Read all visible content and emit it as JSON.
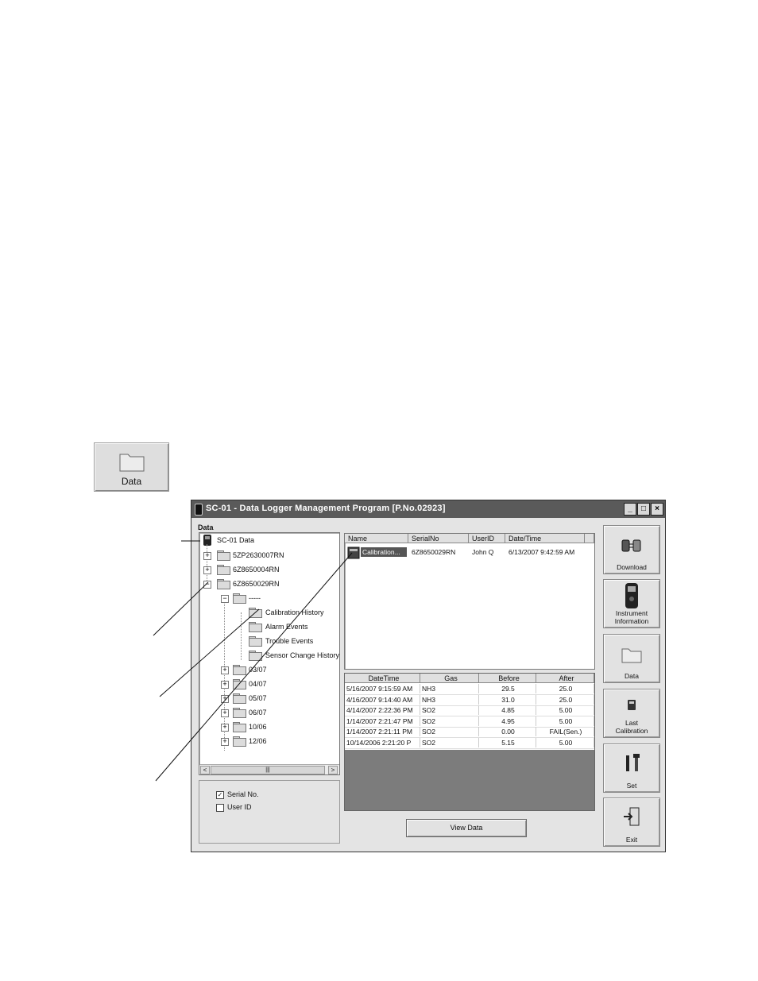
{
  "data_button": {
    "label": "Data"
  },
  "window": {
    "title": "SC-01 - Data Logger Management Program [P.No.02923]",
    "controls": {
      "minimize": "_",
      "maximize": "□",
      "close": "×"
    }
  },
  "tree_group": {
    "label": "Data",
    "root": "SC-01 Data",
    "instruments": [
      "5ZP2630007RN",
      "6Z8650004RN",
      "6Z8650029RN"
    ],
    "expanded_folder": "-----",
    "subfolders": [
      "Calibration History",
      "Alarm Events",
      "Trouble Events",
      "Sensor Change History"
    ],
    "months": [
      "03/07",
      "04/07",
      "05/07",
      "06/07",
      "10/06",
      "12/06"
    ]
  },
  "options": {
    "serial_no": {
      "label": "Serial No.",
      "checked": true,
      "mark": "✓"
    },
    "user_id": {
      "label": "User ID",
      "checked": false,
      "mark": ""
    }
  },
  "file_list": {
    "columns": [
      "Name",
      "SerialNo",
      "UserID",
      "Date/Time"
    ],
    "rows": [
      {
        "name": "Calibration...",
        "serial": "6Z8650029RN",
        "user": "John Q",
        "datetime": "6/13/2007 9:42:59 AM"
      }
    ]
  },
  "data_table": {
    "columns": [
      "DateTime",
      "Gas",
      "Before",
      "After"
    ],
    "rows": [
      [
        "5/16/2007 9:15:59 AM",
        "NH3",
        "29.5",
        "25.0"
      ],
      [
        "4/16/2007 9:14:40 AM",
        "NH3",
        "31.0",
        "25.0"
      ],
      [
        "4/14/2007 2:22:36 PM",
        "SO2",
        "4.85",
        "5.00"
      ],
      [
        "1/14/2007 2:21:47 PM",
        "SO2",
        "4.95",
        "5.00"
      ],
      [
        "1/14/2007 2:21:11 PM",
        "SO2",
        "0.00",
        "FAIL(Sen.)"
      ],
      [
        "10/14/2006 2:21:20 P",
        "SO2",
        "5.15",
        "5.00"
      ]
    ]
  },
  "buttons": {
    "download": "Download",
    "instrument_info_1": "Instrument",
    "instrument_info_2": "Information",
    "data": "Data",
    "last_cal_1": "Last",
    "last_cal_2": "Calibration",
    "set": "Set",
    "exit": "Exit",
    "view_data": "View Data"
  },
  "scrollbar": {
    "left_arrow": "<",
    "thumb": "|||",
    "right_arrow": ">"
  }
}
